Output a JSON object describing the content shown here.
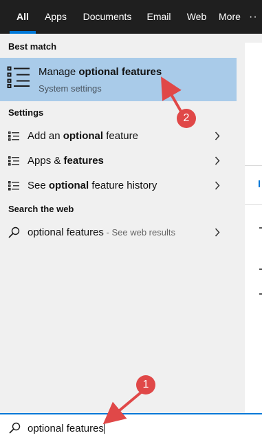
{
  "tabs": [
    {
      "label": "All",
      "active": true
    },
    {
      "label": "Apps",
      "active": false
    },
    {
      "label": "Documents",
      "active": false
    },
    {
      "label": "Email",
      "active": false
    },
    {
      "label": "Web",
      "active": false
    },
    {
      "label": "More",
      "active": false
    }
  ],
  "more_caret_icon": "chevron-down-icon",
  "overflow_icon": "ellipsis-icon",
  "best_match": {
    "header": "Best match",
    "title_prefix": "Manage ",
    "title_bold": "optional features",
    "subtitle": "System settings",
    "icon": "settings-list-icon"
  },
  "settings": {
    "header": "Settings",
    "items": [
      {
        "pre": "Add an ",
        "bold": "optional",
        "post": " feature",
        "icon": "settings-list-icon"
      },
      {
        "pre": "Apps & ",
        "bold": "features",
        "post": "",
        "icon": "settings-list-icon"
      },
      {
        "pre": "See ",
        "bold": "optional",
        "post": " feature history",
        "icon": "settings-list-icon"
      }
    ]
  },
  "web": {
    "header": "Search the web",
    "query": "optional features",
    "hint": " - See web results",
    "icon": "search-icon"
  },
  "search": {
    "value": "optional features",
    "icon": "search-icon"
  },
  "annotations": [
    {
      "number": "1",
      "color": "#e04848"
    },
    {
      "number": "2",
      "color": "#e04848"
    }
  ],
  "colors": {
    "topbar": "#1f1f1f",
    "accent": "#0078d7",
    "highlight": "#a9cbe9",
    "pane": "#f0f0f0"
  }
}
